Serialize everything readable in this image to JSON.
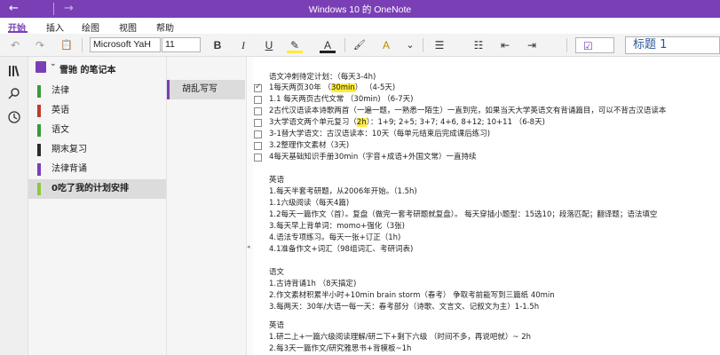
{
  "window": {
    "title": "Windows 10 的 OneNote",
    "back_glyph": "←",
    "forward_glyph": "→"
  },
  "menu": {
    "tabs": [
      "开始",
      "插入",
      "绘图",
      "视图",
      "帮助"
    ]
  },
  "ribbon": {
    "undo": "↶",
    "redo": "↷",
    "paste": "📋",
    "font_name": "Microsoft YaH",
    "font_size": "11",
    "bold": "B",
    "italic": "I",
    "underline": "U",
    "highlight": "✎",
    "font_color": "A",
    "clear_format": "🖌",
    "format_a": "A",
    "dropdown": "⌄",
    "bullets": "☰",
    "numbering": "☷",
    "outdent": "⇤",
    "indent": "⇥",
    "tag": "☑",
    "style": "标题 1"
  },
  "sidebar": {
    "icons": [
      "notebooks-icon",
      "search-icon",
      "recent-icon"
    ]
  },
  "notebook": {
    "name": "雪驰 的笔记本",
    "sort_glyph": "⇅",
    "sections": [
      {
        "label": "法律",
        "color": "#3a9b3a"
      },
      {
        "label": "英语",
        "color": "#c0392b"
      },
      {
        "label": "语文",
        "color": "#3a9b3a"
      },
      {
        "label": "期末复习",
        "color": "#2b2b2b"
      },
      {
        "label": "法律背诵",
        "color": "#7b3fb5"
      },
      {
        "label": "0吃了我的计划安排",
        "color": "#8dc63f"
      }
    ]
  },
  "pages": {
    "items": [
      "胡乱写写"
    ]
  },
  "note": {
    "plan_title": "语文冲刺待定计划：（每天3-4h)",
    "plan_items": [
      {
        "checked": true,
        "pre": "1每天两页30年 （",
        "hl": "30min",
        "post": "） （4-5天)"
      },
      {
        "checked": false,
        "pre": "1.1 每天两页古代文常 （30min) （6-7天)",
        "hl": "",
        "post": ""
      },
      {
        "checked": false,
        "pre": "2古代汉语读本诗歌两首（一遍一题，一熟悉一陌生）一直到完，如果当天大学英语文有背诵篇目，可以不背古汉语读本",
        "hl": "",
        "post": ""
      },
      {
        "checked": false,
        "pre": "3大学语文两个单元复习（",
        "hl": "2h",
        "post": "）：1+9; 2+5; 3+7; 4+6, 8+12; 10+11 （6-8天)"
      },
      {
        "checked": false,
        "pre": "3-1替大学语文：古汉语读本：10天（每单元结束后完成课后练习)",
        "hl": "",
        "post": ""
      },
      {
        "checked": false,
        "pre": "3.2整理作文素材（3天)",
        "hl": "",
        "post": ""
      },
      {
        "checked": false,
        "pre": "4每天基础知识手册30min（字音+成语+外国文常）一直持续",
        "hl": "",
        "post": ""
      }
    ],
    "english_title": "英语",
    "english_lines": [
      "1.每天半套考研题，从2006年开始。（1.5h)",
      "1.1六级阅读（每天4篇)",
      "1.2每天一篇作文（首）。复盘（做完一套考研题就复盘）。 每天穿插小题型：15选10；段落匹配；翻译题；语法填空",
      "3.每天早上背单词：momo+强化（3张)",
      "4.语法专项练习。每天一张+订正（1h)",
      "4.1准备作文+词汇（98组词汇、考研词表)"
    ],
    "chinese_title": "语文",
    "chinese_lines": [
      "1.古诗背诵1h （8天搞定)",
      "2.作文素材积累半小时+10min brain storm（春考） 争取考前能写到三篇纸 40min",
      "3.每两天：30年/大语一每一天：春考部分（诗歌、文言文、记叙文为主）1-1.5h"
    ],
    "english2_title": "英语",
    "english2_lines": [
      "1.研二上+一篇六级阅读理解/研二下+剩下六级 （时间不多，再说吧就）~ 2h",
      "2.每3天一篇作文/研究雅思书+背模板~1h"
    ],
    "highlight_color": "#ffeb3b"
  }
}
